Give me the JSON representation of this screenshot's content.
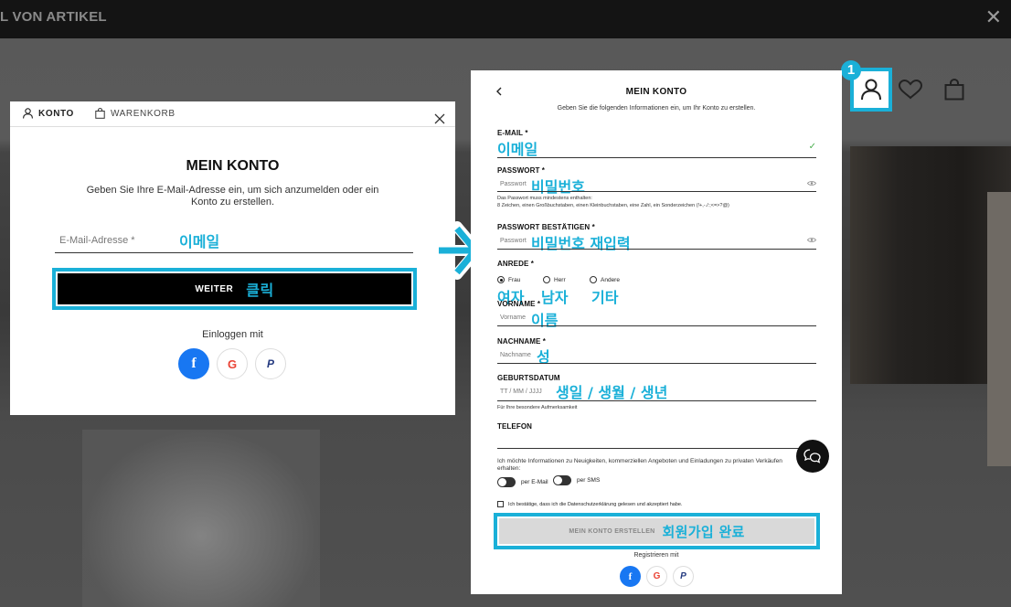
{
  "topbar": {
    "title": "L VON ARTIKEL",
    "close": "✕"
  },
  "step_badge": "1",
  "login": {
    "tabs": {
      "konto": "KONTO",
      "warenkorb": "WARENKORB"
    },
    "title": "MEIN KONTO",
    "description": "Geben Sie Ihre E-Mail-Adresse ein, um sich anzumelden oder ein Konto zu erstellen.",
    "email_placeholder": "E-Mail-Adresse *",
    "email_ko": "이메일",
    "weiter_label": "WEITER",
    "weiter_ko": "클릭",
    "login_with": "Einloggen mit",
    "social": {
      "facebook": "f",
      "google": "G",
      "paypal": "P"
    }
  },
  "register": {
    "title": "MEIN KONTO",
    "subtitle": "Geben Sie die folgenden Informationen ein, um Ihr Konto zu erstellen.",
    "email": {
      "label": "E-MAIL *",
      "ko": "이메일"
    },
    "password": {
      "label": "PASSWORT *",
      "placeholder": "Passwort",
      "ko": "비밀번호",
      "hint1": "Das Passwort muss mindestens enthalten:",
      "hint2": "8 Zeichen, einen Großbuchstaben, einen Kleinbuchstaben, eine Zahl, ein Sonderzeichen (!+,-./:;<=>?@)"
    },
    "password_confirm": {
      "label": "PASSWORT BESTÄTIGEN *",
      "placeholder": "Passwort",
      "ko": "비밀번호 재입력"
    },
    "salutation": {
      "label": "ANREDE *",
      "options": [
        "Frau",
        "Herr",
        "Andere"
      ],
      "ko": [
        "여자",
        "남자",
        "기타"
      ]
    },
    "firstname": {
      "label": "VORNAME *",
      "placeholder": "Vorname",
      "ko": "이름"
    },
    "lastname": {
      "label": "NACHNAME *",
      "placeholder": "Nachname",
      "ko": "성"
    },
    "birthdate": {
      "label": "GEBURTSDATUM",
      "placeholder": "TT /  MM /  JJJJ",
      "ko": "생일 / 생월 / 생년",
      "note": "Für Ihre besondere Aufmerksamkeit"
    },
    "phone": {
      "label": "TELEFON"
    },
    "newsletter": "Ich möchte Informationen zu Neuigkeiten, kommerziellen Angeboten und Einladungen zu privaten Verkäufen erhalten:",
    "per_email": "per E-Mail",
    "per_sms": "per SMS",
    "privacy": "Ich bestätige, dass ich die Datenschutzerklärung gelesen und akzeptiert habe.",
    "submit_label": "MEIN KONTO ERSTELLEN",
    "submit_ko": "회원가입 완료",
    "register_with": "Registrieren mit",
    "social": {
      "facebook": "f",
      "google": "G",
      "paypal": "P"
    }
  },
  "colors": {
    "highlight": "#1ab0d8",
    "facebook": "#1877f2"
  }
}
